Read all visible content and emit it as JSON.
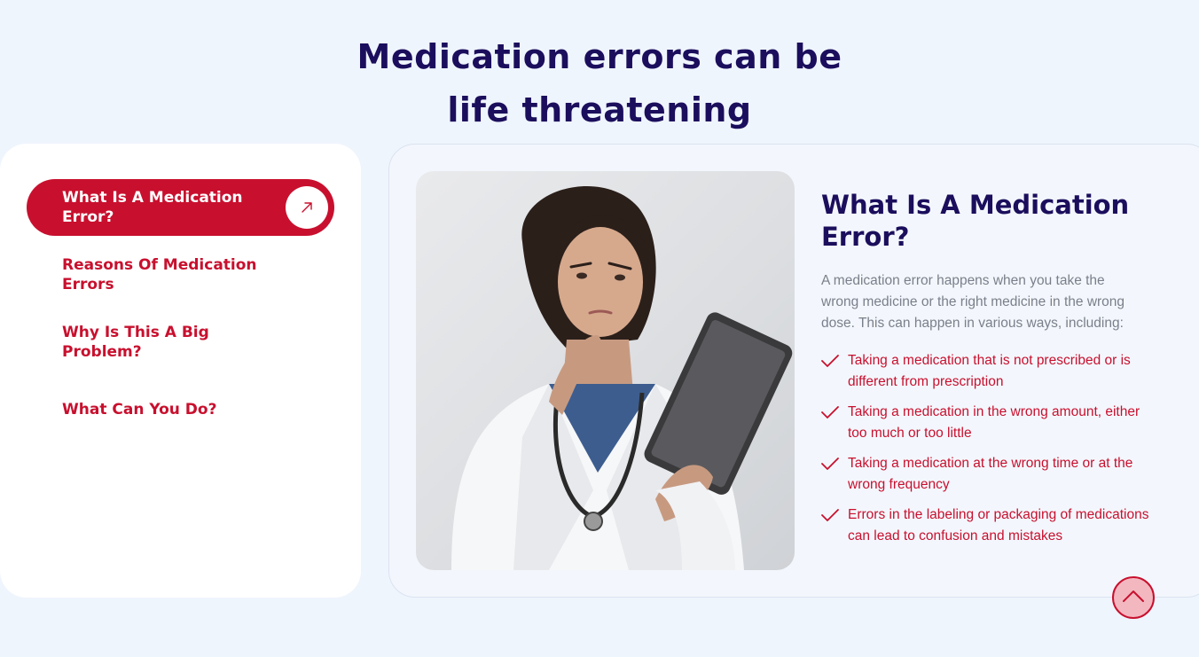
{
  "heading": {
    "line1": "Medication errors can be",
    "line2": "life threatening"
  },
  "nav": {
    "items": [
      {
        "label": "What Is A Medication Error?",
        "active": true
      },
      {
        "label": "Reasons Of Medication Errors",
        "active": false
      },
      {
        "label": "Why Is This A Big Problem?",
        "active": false
      },
      {
        "label": "What Can You Do?",
        "active": false
      }
    ],
    "active_icon": "arrow-up-right-icon"
  },
  "content": {
    "title": "What Is A Medication Error?",
    "description": "A medication error happens when you take the wrong medicine or the right medicine in the wrong dose. This can happen in various ways, including:",
    "checklist": [
      "Taking a medication that is not prescribed or is different from prescription",
      "Taking a medication in the wrong amount, either too much or too little",
      "Taking a medication at the wrong time or at the wrong frequency",
      "Errors in the labeling or packaging of medications can lead to confusion and mistakes"
    ],
    "check_icon": "checkmark-icon"
  },
  "scroll_top": {
    "icon": "chevron-up-icon"
  },
  "colors": {
    "brand_red": "#c8102e",
    "heading_navy": "#1b0e5c",
    "page_bg": "#eff5fd",
    "body_text": "#7a7f8a"
  }
}
